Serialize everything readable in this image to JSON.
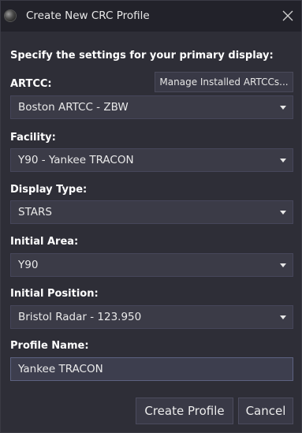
{
  "window": {
    "title": "Create New CRC Profile"
  },
  "heading": "Specify the settings for your primary display:",
  "artcc": {
    "label": "ARTCC:",
    "value": "Boston ARTCC - ZBW",
    "manage_button": "Manage Installed ARTCCs..."
  },
  "facility": {
    "label": "Facility:",
    "value": "Y90 - Yankee TRACON"
  },
  "display_type": {
    "label": "Display Type:",
    "value": "STARS"
  },
  "initial_area": {
    "label": "Initial Area:",
    "value": "Y90"
  },
  "initial_position": {
    "label": "Initial Position:",
    "value": "Bristol Radar - 123.950"
  },
  "profile_name": {
    "label": "Profile Name:",
    "value": "Yankee TRACON"
  },
  "buttons": {
    "create": "Create Profile",
    "cancel": "Cancel"
  }
}
